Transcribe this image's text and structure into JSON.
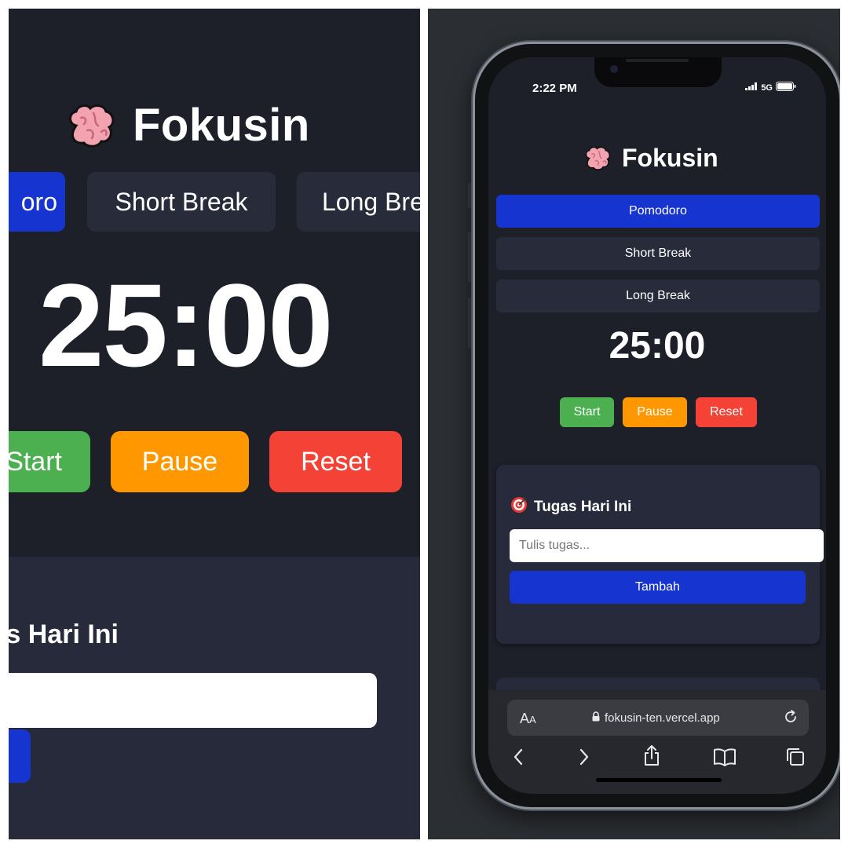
{
  "app": {
    "brand_emoji": "brain-icon",
    "title": "Fokusin"
  },
  "modes": {
    "pomodoro_full": "Pomodoro",
    "pomodoro_cropped": "oro",
    "short": "Short Break",
    "long_full": "Long Break",
    "long_cropped": "Long Bre"
  },
  "timer": "25:00",
  "controls": {
    "start_full": "Start",
    "start_cropped": "Start",
    "pause": "Pause",
    "reset": "Reset"
  },
  "tasks": {
    "title": "Tugas Hari Ini",
    "title_cropped": "s Hari Ini",
    "input_placeholder": "Tulis tugas...",
    "input_placeholder_cropped": "as...",
    "add_label": "Tambah"
  },
  "phone": {
    "time": "2:22 PM",
    "network": "5G",
    "url": "fokusin-ten.vercel.app",
    "text_size_label": "AA"
  },
  "colors": {
    "background": "#1d1f29",
    "card": "#262a3a",
    "accent_blue": "#1634cf",
    "start_green": "#4caf50",
    "pause_orange": "#ff9800",
    "reset_red": "#f44336"
  }
}
